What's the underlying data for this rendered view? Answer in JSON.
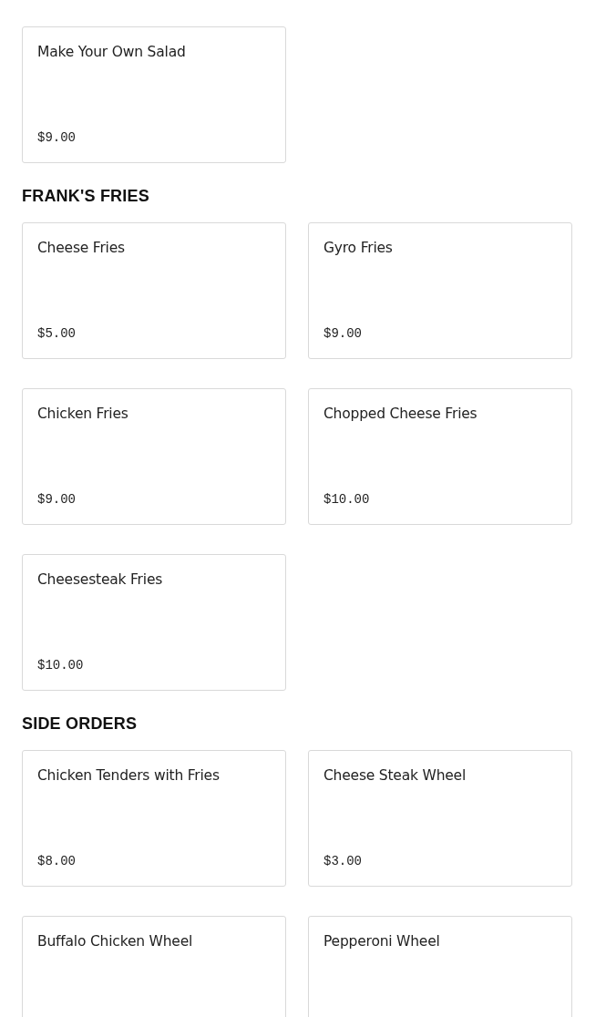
{
  "sections": [
    {
      "items": [
        {
          "name": "Make Your Own Salad",
          "price": "$9.00"
        }
      ]
    },
    {
      "heading": "FRANK'S FRIES",
      "items": [
        {
          "name": "Cheese Fries",
          "price": "$5.00"
        },
        {
          "name": "Gyro Fries",
          "price": "$9.00"
        },
        {
          "name": "Chicken Fries",
          "price": "$9.00"
        },
        {
          "name": "Chopped Cheese Fries",
          "price": "$10.00"
        },
        {
          "name": "Cheesesteak Fries",
          "price": "$10.00"
        }
      ]
    },
    {
      "heading": "SIDE ORDERS",
      "items": [
        {
          "name": "Chicken Tenders with Fries",
          "price": "$8.00"
        },
        {
          "name": "Cheese Steak Wheel",
          "price": "$3.00"
        },
        {
          "name": "Buffalo Chicken Wheel"
        },
        {
          "name": "Pepperoni Wheel"
        }
      ]
    }
  ]
}
